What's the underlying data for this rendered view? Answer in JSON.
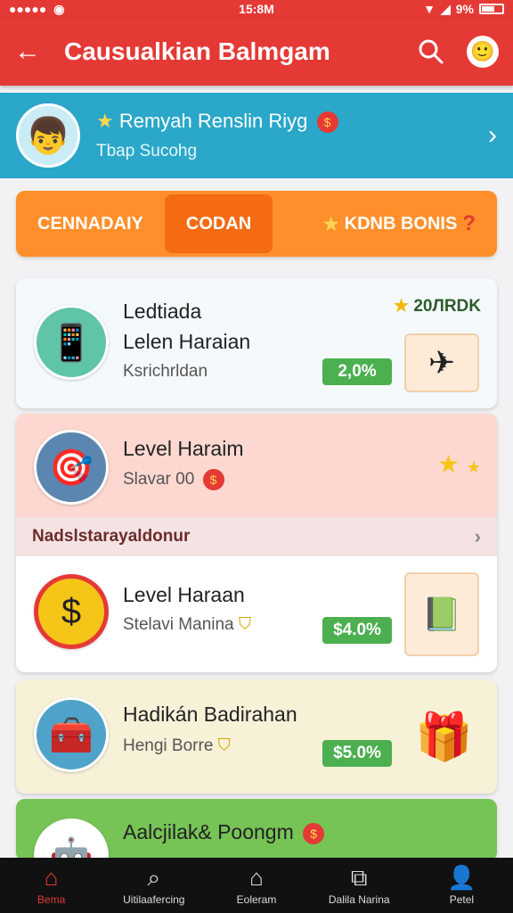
{
  "status_bar": {
    "carrier": "●●●●●",
    "time": "15:8M",
    "battery_text": "9%"
  },
  "app_bar": {
    "title": "Causualkian Balmgam",
    "back_icon": "back-arrow-icon",
    "search_icon": "search-icon",
    "avatar_icon": "avatar-icon"
  },
  "banner": {
    "title": "Remyah Renslin Riyg",
    "subtitle": "Tbap Sucohg"
  },
  "tabs": [
    {
      "label": "CENNADAIY"
    },
    {
      "label": "CODAN"
    },
    {
      "label": "KDNB BONIS"
    }
  ],
  "cards": [
    {
      "title_line1": "Ledtiada",
      "title_line2": "Lelen Haraian",
      "subtitle": "Ksrichrldan",
      "percent": "2,0%",
      "corner": "20ЛRDK"
    },
    {
      "title": "Level Haraim",
      "subtitle": "Slavar 00",
      "section_label": "Nadslstarayaldonur"
    },
    {
      "title": "Level Haraan",
      "subtitle": "Stelavi Manina",
      "percent": "$4.0%"
    },
    {
      "title": "Hadikán  Badirahan",
      "subtitle": "Hengi Borre",
      "percent": "$5.0%"
    },
    {
      "title": "Aalcjilak& Poongm"
    }
  ],
  "bottom_nav": [
    {
      "label": "Bema",
      "icon": "home-icon"
    },
    {
      "label": "Uitilaafercing",
      "icon": "search-icon"
    },
    {
      "label": "Eoleram",
      "icon": "shop-icon"
    },
    {
      "label": "Dalila Narina",
      "icon": "share-icon"
    },
    {
      "label": "Petel",
      "icon": "profile-icon"
    }
  ],
  "colors": {
    "primary": "#e53935",
    "banner": "#2aa7c9",
    "tabs": "#ff8f2a",
    "success": "#4caf50"
  }
}
